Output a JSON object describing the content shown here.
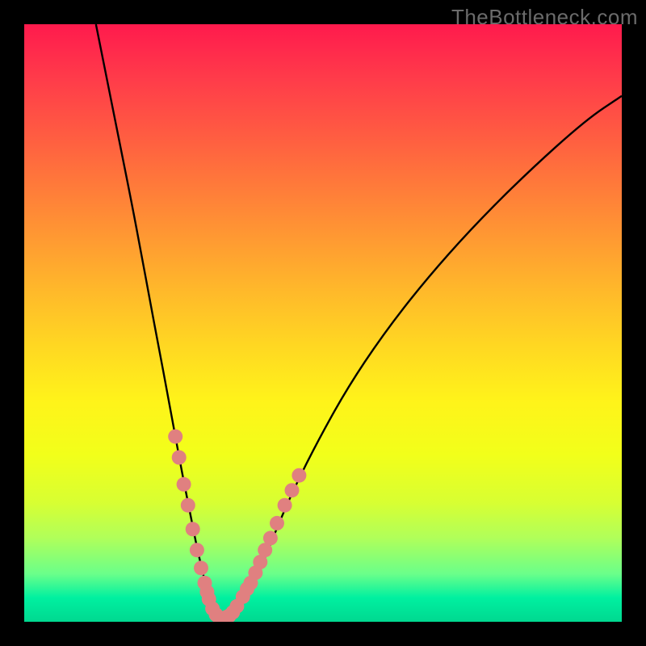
{
  "watermark": "TheBottleneck.com",
  "chart_data": {
    "type": "line",
    "title": "",
    "xlabel": "",
    "ylabel": "",
    "xlim": [
      0,
      100
    ],
    "ylim": [
      0,
      100
    ],
    "grid": false,
    "legend": false,
    "series": [
      {
        "name": "curve",
        "x": [
          12,
          14,
          16,
          18,
          19.5,
          21,
          22.5,
          24,
          25.3,
          26.4,
          27.4,
          28.2,
          29,
          29.7,
          30.3,
          30.8,
          31.3,
          31.7,
          32.1,
          32.4,
          33,
          33.5,
          34.5,
          35.5,
          36.8,
          38.2,
          40,
          42,
          45,
          49,
          54,
          60,
          67,
          75,
          84,
          94,
          100
        ],
        "y": [
          100,
          90,
          80,
          70,
          62,
          54,
          46,
          38,
          31,
          25,
          20,
          16,
          12,
          9,
          6.5,
          4.5,
          3,
          2,
          1.3,
          0.8,
          0.5,
          0.6,
          1.2,
          2.3,
          4,
          6.5,
          10,
          15,
          22,
          30,
          39,
          48,
          57,
          66,
          75,
          84,
          88
        ]
      }
    ],
    "markers": {
      "name": "highlight-points",
      "color": "#e08080",
      "points": [
        {
          "x": 25.3,
          "y": 31
        },
        {
          "x": 25.9,
          "y": 27.5
        },
        {
          "x": 26.7,
          "y": 23
        },
        {
          "x": 27.4,
          "y": 19.5
        },
        {
          "x": 28.2,
          "y": 15.5
        },
        {
          "x": 28.9,
          "y": 12
        },
        {
          "x": 29.6,
          "y": 9
        },
        {
          "x": 30.2,
          "y": 6.5
        },
        {
          "x": 30.6,
          "y": 5
        },
        {
          "x": 30.9,
          "y": 3.8
        },
        {
          "x": 31.5,
          "y": 2.2
        },
        {
          "x": 32.1,
          "y": 1.2
        },
        {
          "x": 32.6,
          "y": 0.7
        },
        {
          "x": 33.1,
          "y": 0.55
        },
        {
          "x": 33.7,
          "y": 0.7
        },
        {
          "x": 34.3,
          "y": 1.0
        },
        {
          "x": 34.9,
          "y": 1.6
        },
        {
          "x": 35.6,
          "y": 2.6
        },
        {
          "x": 36.6,
          "y": 4.2
        },
        {
          "x": 37.3,
          "y": 5.5
        },
        {
          "x": 37.9,
          "y": 6.5
        },
        {
          "x": 38.7,
          "y": 8.2
        },
        {
          "x": 39.5,
          "y": 10
        },
        {
          "x": 40.3,
          "y": 12
        },
        {
          "x": 41.2,
          "y": 14
        },
        {
          "x": 42.3,
          "y": 16.5
        },
        {
          "x": 43.6,
          "y": 19.5
        },
        {
          "x": 44.8,
          "y": 22
        },
        {
          "x": 46.0,
          "y": 24.5
        }
      ]
    }
  }
}
